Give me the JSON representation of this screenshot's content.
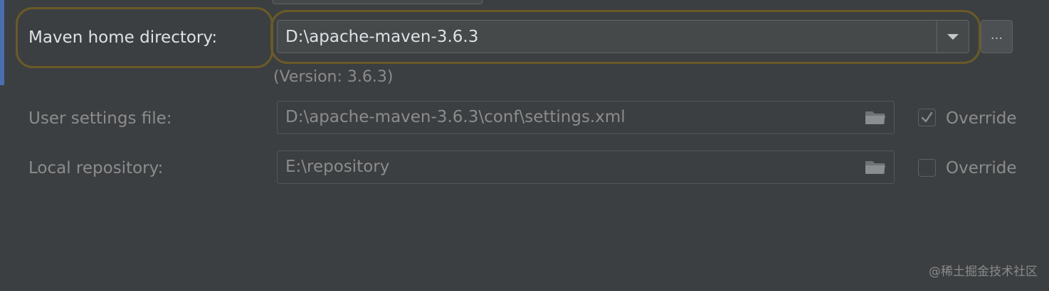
{
  "maven_home": {
    "label": "Maven home directory:",
    "value": "D:\\apache-maven-3.6.3",
    "browse_label": "...",
    "version_text": "(Version: 3.6.3)"
  },
  "user_settings": {
    "label": "User settings file:",
    "value": "D:\\apache-maven-3.6.3\\conf\\settings.xml",
    "override_label": "Override",
    "override_checked": true
  },
  "local_repository": {
    "label": "Local repository:",
    "value": "E:\\repository",
    "override_label": "Override",
    "override_checked": false
  },
  "watermark": "@稀土掘金技术社区",
  "icons": {
    "dropdown": "chevron-down-icon",
    "folder": "folder-icon",
    "check": "check-icon"
  },
  "colors": {
    "background": "#3c3f41",
    "highlight": "#6b5a28",
    "input_background": "#45494a",
    "accent": "#4b6eaf"
  }
}
